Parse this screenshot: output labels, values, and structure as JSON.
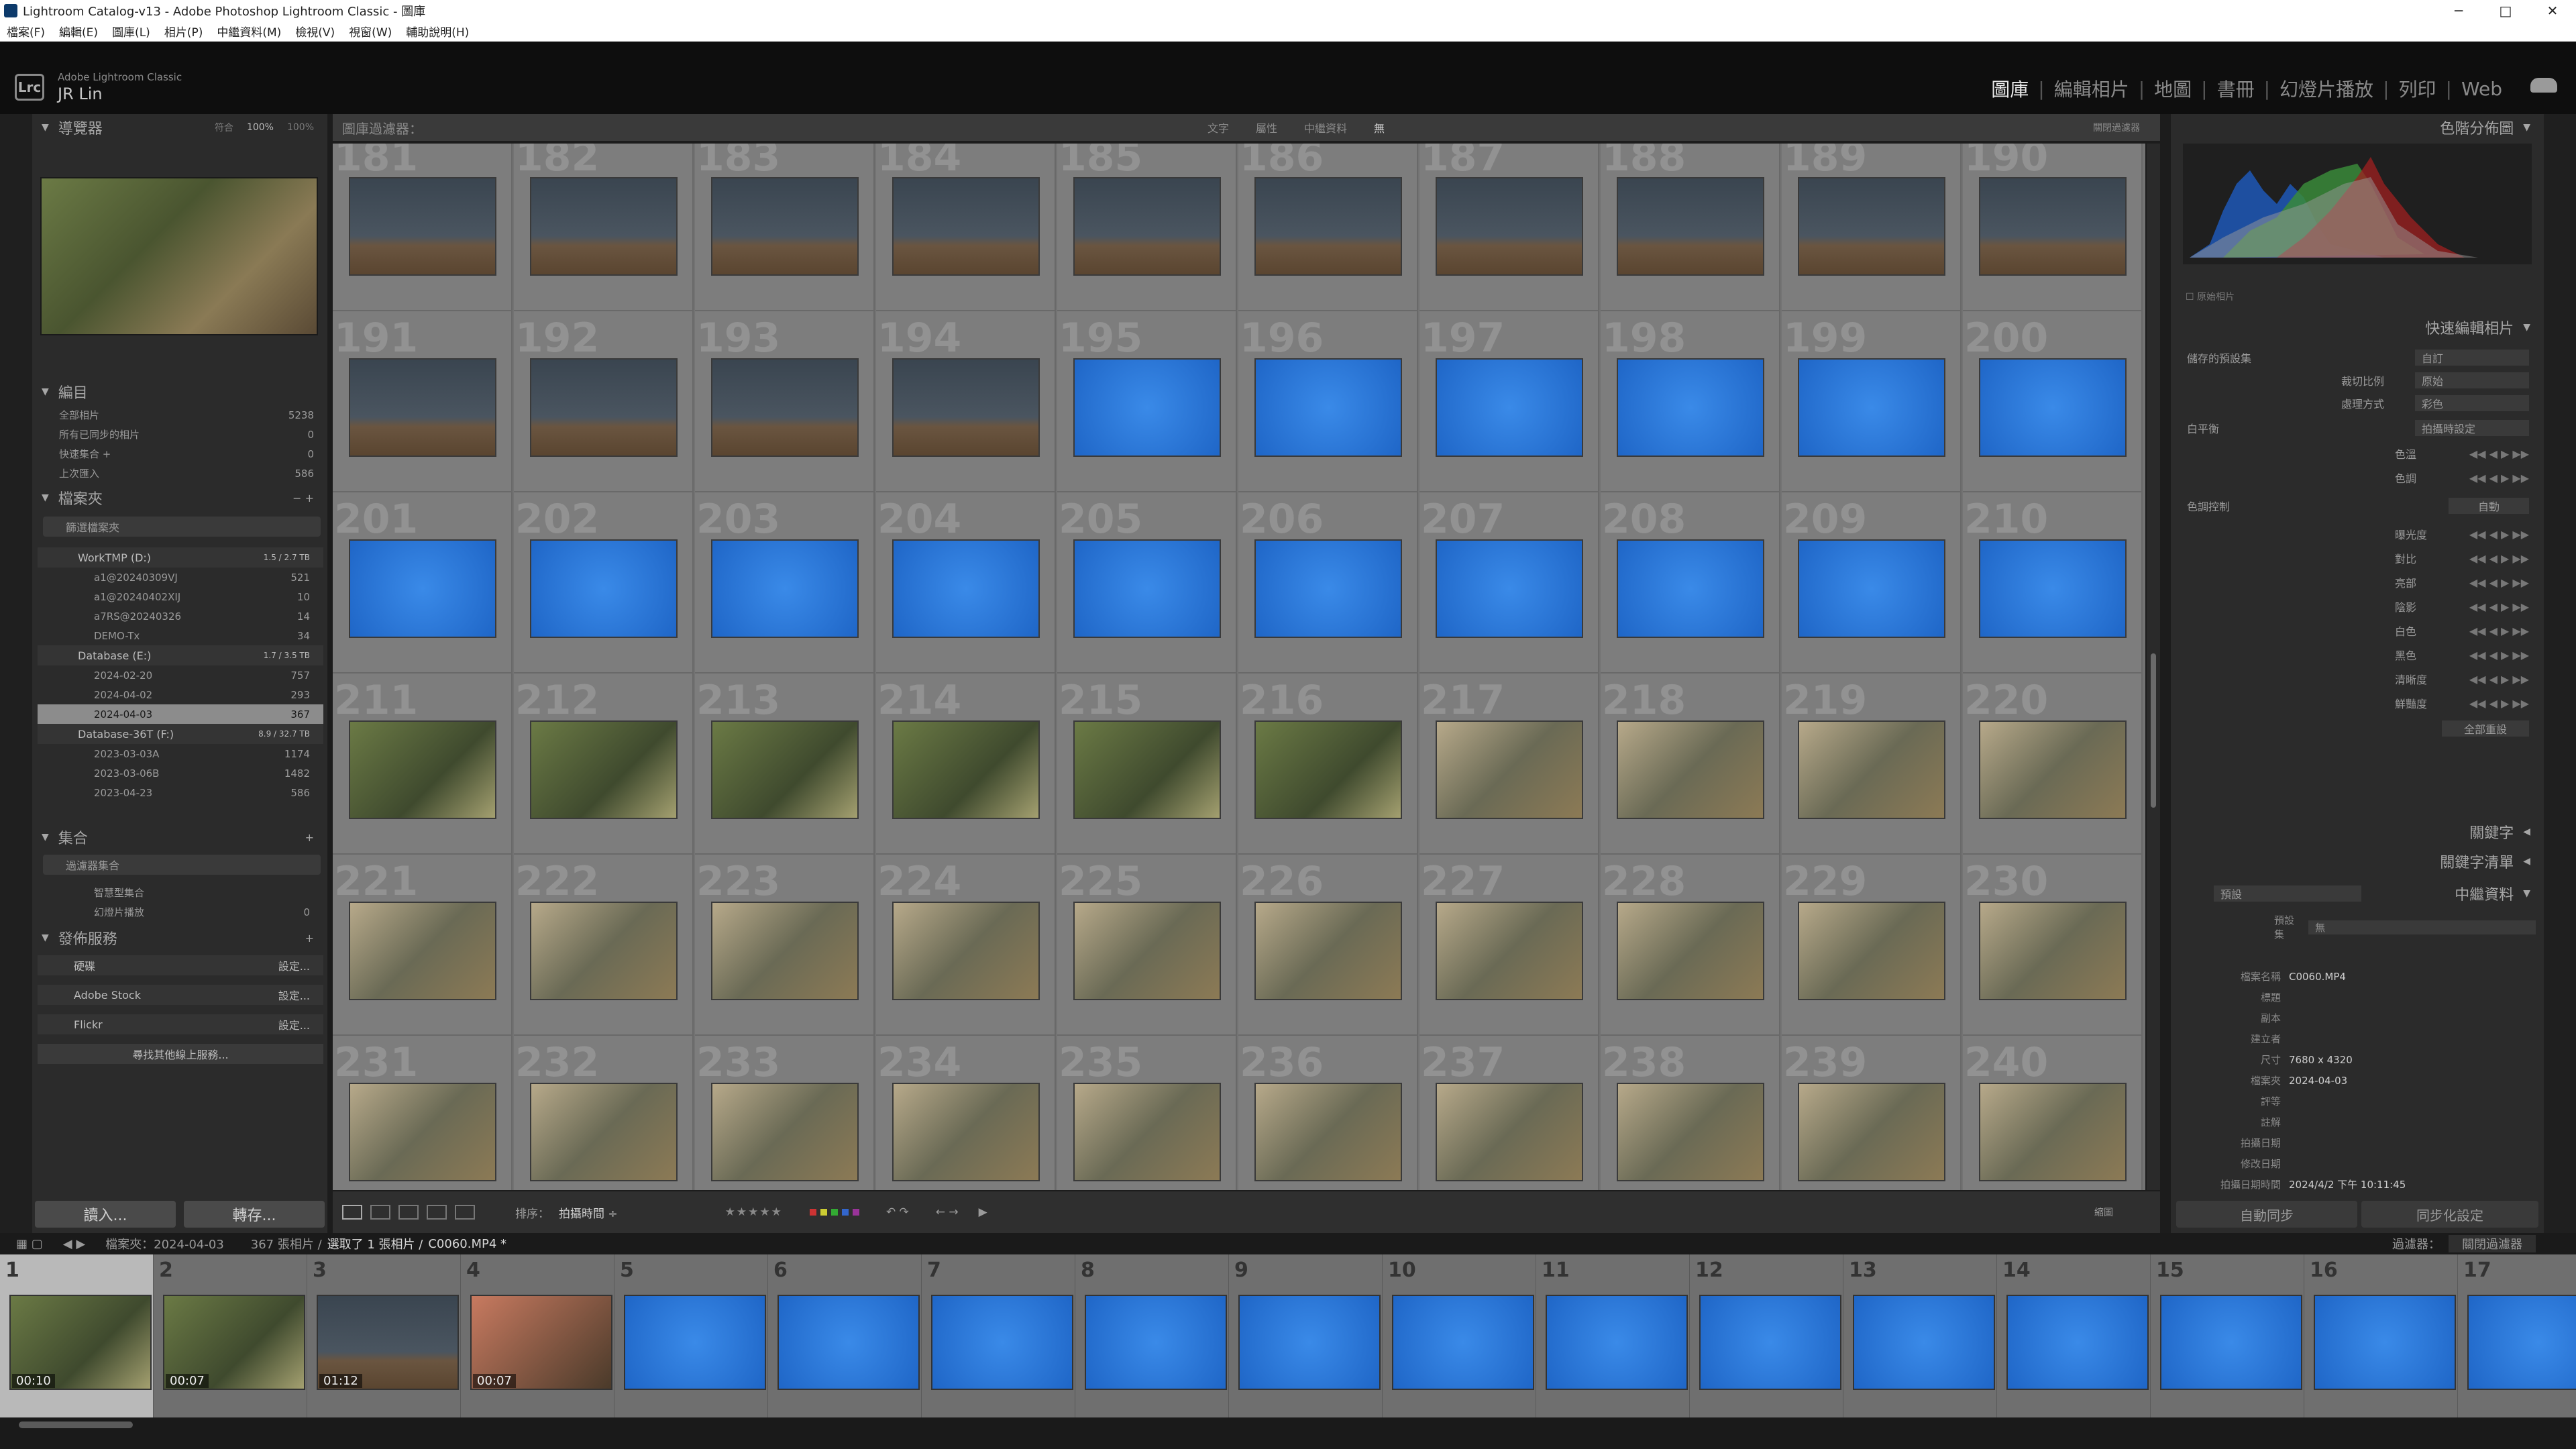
{
  "window": {
    "title": "Lightroom Catalog-v13 - Adobe Photoshop Lightroom Classic - 圖庫",
    "minimize": "─",
    "maximize": "□",
    "close": "✕"
  },
  "menu": [
    "檔案(F)",
    "編輯(E)",
    "圖庫(L)",
    "相片(P)",
    "中繼資料(M)",
    "檢視(V)",
    "視窗(W)",
    "輔助說明(H)"
  ],
  "identity": {
    "badge": "Lrc",
    "product": "Adobe Lightroom Classic",
    "user": "JR Lin"
  },
  "modules": {
    "library": "圖庫",
    "develop": "編輯相片",
    "map": "地圖",
    "book": "書冊",
    "slideshow": "幻燈片播放",
    "print": "列印",
    "web": "Web"
  },
  "navigator": {
    "title": "導覽器",
    "fit": "符合",
    "zoom100": "100%",
    "zoom": "100%"
  },
  "catalog": {
    "title": "編目",
    "items": [
      {
        "label": "全部相片",
        "count": "5238"
      },
      {
        "label": "所有已同步的相片",
        "count": "0"
      },
      {
        "label": "快速集合 +",
        "count": "0"
      },
      {
        "label": "上次匯入",
        "count": "586"
      }
    ]
  },
  "folders": {
    "title": "檔案夾",
    "filter": "篩選檔案夾",
    "volumes": [
      {
        "name": "WorkTMP (D:)",
        "size": "1.5 / 2.7 TB",
        "items": [
          {
            "label": "a1@20240309VJ",
            "count": "521"
          },
          {
            "label": "a1@20240402XIJ",
            "count": "10"
          },
          {
            "label": "a7RS@20240326",
            "count": "14"
          },
          {
            "label": "DEMO-Tx",
            "count": "34"
          }
        ]
      },
      {
        "name": "Database (E:)",
        "size": "1.7 / 3.5 TB",
        "items": [
          {
            "label": "2024-02-20",
            "count": "757"
          },
          {
            "label": "2024-04-02",
            "count": "293"
          },
          {
            "label": "2024-04-03",
            "count": "367"
          }
        ]
      },
      {
        "name": "Database-36T (F:)",
        "size": "8.9 / 32.7 TB",
        "items": [
          {
            "label": "2023-03-03A",
            "count": "1174"
          },
          {
            "label": "2023-03-06B",
            "count": "1482"
          },
          {
            "label": "2023-04-23",
            "count": "586"
          }
        ]
      }
    ]
  },
  "collections": {
    "title": "集合",
    "filter": "過濾器集合",
    "items": [
      {
        "label": "智慧型集合",
        "count": ""
      },
      {
        "label": "幻燈片播放",
        "count": "0"
      }
    ]
  },
  "publish": {
    "title": "發佈服務",
    "items": [
      {
        "label": "硬碟",
        "action": "設定..."
      },
      {
        "label": "Adobe Stock",
        "action": "設定..."
      },
      {
        "label": "Flickr",
        "action": "設定..."
      }
    ],
    "find": "尋找其他線上服務..."
  },
  "leftButtons": {
    "import": "讀入...",
    "export": "轉存..."
  },
  "filterBar": {
    "title": "圖庫過濾器：",
    "text": "文字",
    "attribute": "屬性",
    "metadata": "中繼資料",
    "none": "無",
    "presets": "關閉過濾器"
  },
  "grid": {
    "rows": [
      {
        "start": 181,
        "type": "bird"
      },
      {
        "start": 191,
        "type": "bird4blue6"
      },
      {
        "start": 201,
        "type": "blue"
      },
      {
        "start": 211,
        "type": "green"
      },
      {
        "start": 221,
        "type": "flower"
      },
      {
        "start": 231,
        "type": "flower"
      }
    ]
  },
  "toolbar": {
    "sort": "排序：",
    "sortValue": "拍攝時間 ÷",
    "stars": "★★★★★",
    "thumbs": "縮圖"
  },
  "right": {
    "histogram": "色階分佈圖",
    "originalPhoto": "原始相片",
    "quickDevelop": "快速編輯相片",
    "savedPreset": "儲存的預設集",
    "presetValue": "自訂",
    "cropRatio": "裁切比例",
    "cropValue": "原始",
    "treatment": "處理方式",
    "treatmentValue": "彩色",
    "wb": "白平衡",
    "wbValue": "拍攝時設定",
    "temp": "色溫",
    "tint": "色調",
    "tone": "色調控制",
    "auto": "自動",
    "exposure": "曝光度",
    "contrast": "對比",
    "highlights": "亮部",
    "shadows": "陰影",
    "whites": "白色",
    "blacks": "黑色",
    "clarity": "清晰度",
    "vibrance": "鮮豔度",
    "reset": "全部重設",
    "keywords": "關鍵字",
    "keywordList": "關鍵字清單",
    "metadata": "中繼資料",
    "metaPreset": "預設",
    "presetLabel": "預設集",
    "metaPresetValue": "無",
    "fields": [
      {
        "label": "檔案名稱",
        "value": "C0060.MP4"
      },
      {
        "label": "標題",
        "value": ""
      },
      {
        "label": "副本",
        "value": ""
      },
      {
        "label": "建立者",
        "value": ""
      },
      {
        "label": "尺寸",
        "value": "7680 x 4320"
      },
      {
        "label": "檔案夾",
        "value": "2024-04-03"
      },
      {
        "label": "評等",
        "value": ""
      },
      {
        "label": "註解",
        "value": ""
      },
      {
        "label": "拍攝日期",
        "value": ""
      },
      {
        "label": "修改日期",
        "value": ""
      },
      {
        "label": "拍攝日期時間",
        "value": "2024/4/2 下午 10:11:45"
      }
    ],
    "sync": "自動同步",
    "syncSettings": "同步化設定"
  },
  "statusbar": {
    "folder": "檔案夾：2024-04-03",
    "count": "367 張相片 /",
    "selected": "選取了 1 張相片 /",
    "file": "C0060.MP4 *",
    "filterLabel": "過濾器：",
    "filterValue": "關閉過濾器"
  },
  "filmstrip": [
    {
      "n": "1",
      "time": "00:10",
      "t": "green"
    },
    {
      "n": "2",
      "time": "00:07",
      "t": "green"
    },
    {
      "n": "3",
      "time": "01:12",
      "t": "bird"
    },
    {
      "n": "4",
      "time": "00:07",
      "t": "red"
    },
    {
      "n": "5",
      "t": "blue"
    },
    {
      "n": "6",
      "t": "blue"
    },
    {
      "n": "7",
      "t": "blue"
    },
    {
      "n": "8",
      "t": "blue"
    },
    {
      "n": "9",
      "t": "blue"
    },
    {
      "n": "10",
      "t": "blue"
    },
    {
      "n": "11",
      "t": "blue"
    },
    {
      "n": "12",
      "t": "blue"
    },
    {
      "n": "13",
      "t": "blue"
    },
    {
      "n": "14",
      "t": "blue"
    },
    {
      "n": "15",
      "t": "blue"
    },
    {
      "n": "16",
      "t": "blue"
    },
    {
      "n": "17",
      "t": "blue"
    }
  ]
}
